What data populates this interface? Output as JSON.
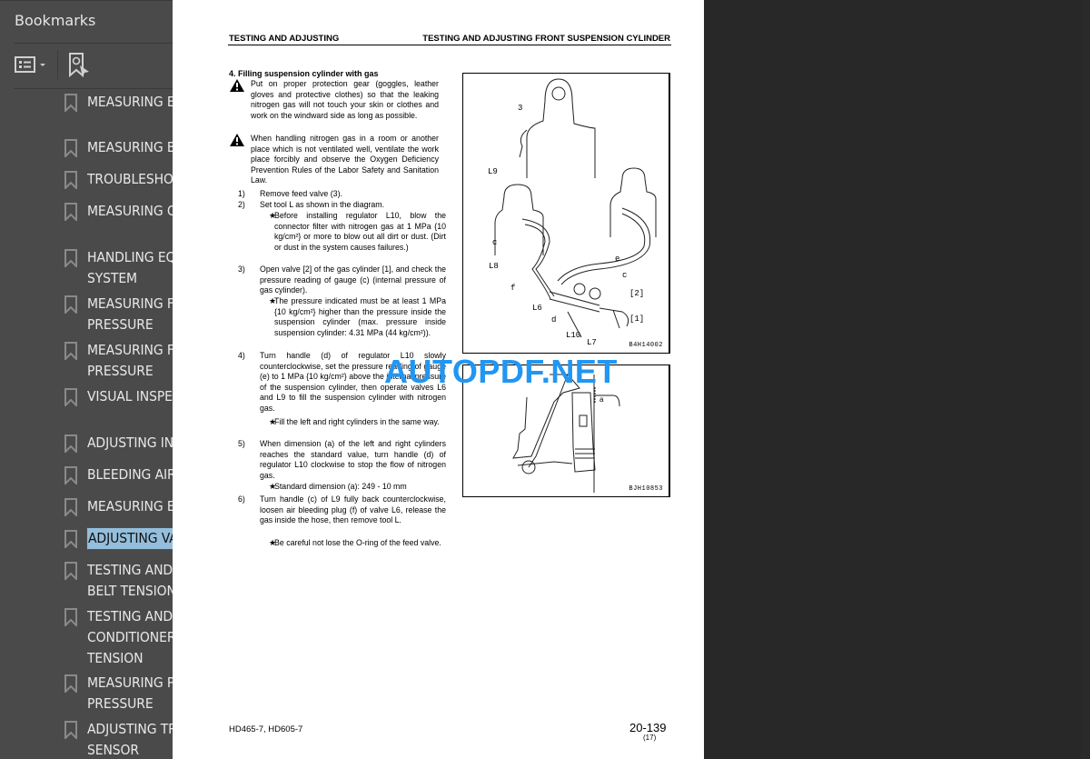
{
  "sidebar": {
    "title": "Bookmarks",
    "close_icon": "close-icon",
    "toolbar": {
      "options_icon": "list-options-icon",
      "find_icon": "find-current-bookmark-icon"
    },
    "selected_index": 13,
    "items": [
      {
        "label": "MEASURING EXHAUST TEMPERATURE"
      },
      {
        "label": "MEASURING BLOW-BY PRESSURE"
      },
      {
        "label": "TROUBLESHOOTING OF INJECTOR"
      },
      {
        "label": "MEASURING COMPRESSION PRESSURE"
      },
      {
        "label": "HANDLING EQUIPMENT IN FUEL SYSTEM"
      },
      {
        "label": "MEASURING FUEL PUMP OUTLET PORT PRESSURE"
      },
      {
        "label": "MEASURING FUEL PUMP INLET PORT PRESSURE"
      },
      {
        "label": "VISUAL INSPECTION OF RETURN FUEL"
      },
      {
        "label": "ADJUSTING INJECTOR SET LOAD"
      },
      {
        "label": "BLEEDING AIR FROM FUEL CIRCUIT"
      },
      {
        "label": "MEASURING EXHAUST COLOR"
      },
      {
        "label": "ADJUSTING VALVE CLEARANCE"
      },
      {
        "label": "TESTING AND ADJUSTING ALTERNATOR BELT TENSION"
      },
      {
        "label": "TESTING AND ADJUSTING,AIR CONDITIONER COMPRESSOR BELT TENSION"
      },
      {
        "label": "MEASURING POWER TRAIN OIL PRESSURE"
      },
      {
        "label": "ADJUSTING TRANSMISSION SPEED SENSOR"
      }
    ]
  },
  "watermark": "AUTOPDF.NET",
  "document": {
    "header_left": "TESTING AND ADJUSTING",
    "header_right": "TESTING AND ADJUSTING FRONT SUSPENSION CYLINDER",
    "section_title": "4.  Filling suspension cylinder with gas",
    "warnings": [
      "Put on proper protection gear (goggles, leather gloves and protective clothes) so that the leaking nitrogen gas will not touch your skin or clothes and work on the windward side as long as possible.",
      "When handling nitrogen gas in a room or another place which is not ventilated well, ventilate the work place forcibly and observe the Oxygen Deficiency Prevention Rules of the Labor Safety and Sanitation Law."
    ],
    "steps": [
      {
        "num": "1)",
        "text": "Remove feed valve (3)."
      },
      {
        "num": "2)",
        "text": "Set tool L as shown in the diagram."
      },
      {
        "num": "★",
        "text": "Before installing regulator L10, blow the connector filter with nitrogen gas at 1 MPa {10 kg/cm²} or more to blow out all dirt or dust. (Dirt or dust in the system causes failures.)"
      },
      {
        "num": "3)",
        "text": "Open valve [2] of the gas cylinder [1], and check the pressure reading of gauge (c) (internal pressure of gas cylinder)."
      },
      {
        "num": "★",
        "text": "The pressure indicated must be at least 1 MPa {10 kg/cm²} higher than the pressure inside the suspension cylinder (max. pressure inside suspension cylinder: 4.31 MPa (44 kg/cm²))."
      },
      {
        "num": "4)",
        "text": "Turn handle (d) of regulator L10 slowly counterclockwise, set the pressure reading of gauge (e) to 1 MPa {10 kg/cm²} above the internal pressure of the suspension cylinder, then operate valves L6 and L9 to fill the suspension cylinder with nitrogen gas."
      },
      {
        "num": "★",
        "text": "Fill the left and right cylinders in the same way."
      },
      {
        "num": "5)",
        "text": "When dimension (a) of the left and right cylinders reaches the standard value, turn handle (d) of regulator L10 clockwise to stop the flow of nitrogen gas."
      },
      {
        "num": "★",
        "text": "Standard dimension (a): 249 - 10 mm"
      },
      {
        "num": "6)",
        "text": "Turn handle (c) of L9 fully back counterclockwise, loosen air bleeding plug (f) of valve L6, release the gas inside the hose, then remove tool L."
      },
      {
        "num": "★",
        "text": "Be careful not lose the O-ring of the feed valve."
      }
    ],
    "figure1": {
      "code": "B4H14002",
      "labels": [
        "3",
        "L9",
        "c",
        "L8",
        "e",
        "c",
        "f",
        "[2]",
        "L6",
        "d",
        "[1]",
        "L10",
        "L7"
      ]
    },
    "figure2": {
      "code": "BJH10853",
      "labels": [
        "a"
      ]
    },
    "footer_left": "HD465-7, HD605-7",
    "page_number": "20-139",
    "page_sub": "(17)"
  }
}
